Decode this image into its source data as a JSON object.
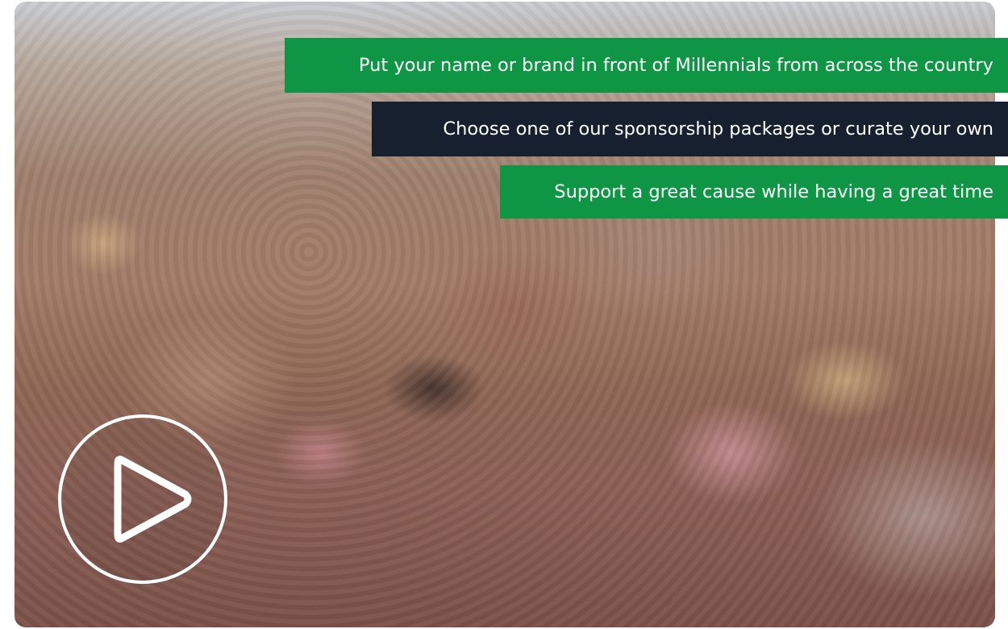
{
  "hero": {
    "image_subject": "crowd-photo",
    "banners": [
      {
        "text": "Put your name or brand in front of Millennials from across the country",
        "color": "#0e9645"
      },
      {
        "text": "Choose one of our sponsorship packages or curate your own",
        "color": "#16202f"
      },
      {
        "text": "Support a great cause while having  a great time",
        "color": "#0e9645"
      }
    ],
    "play_button": {
      "icon": "play-icon",
      "color": "#ffffff"
    }
  }
}
